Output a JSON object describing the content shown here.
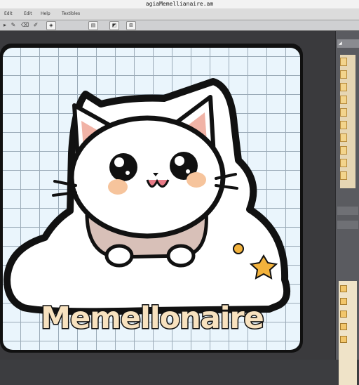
{
  "window": {
    "title": "agiaMemellianaire.am"
  },
  "menu": {
    "items": [
      "Edit",
      "Edit",
      "Help",
      "Textibles"
    ]
  },
  "toolbar": {
    "icons": [
      "select-icon",
      "pen-icon",
      "stamp-icon",
      "paint-icon",
      "fill-icon",
      "layer-icon",
      "grid-icon",
      "export-icon"
    ],
    "glyphs": [
      "▸",
      "✎",
      "⌫",
      "✐",
      "◈",
      "▤",
      "◩",
      "⊞"
    ]
  },
  "canvas": {
    "sticker_text": "Memellonaire",
    "colors": {
      "outline": "#111111",
      "fur": "#ffffff",
      "ear_inner": "#f1b3a6",
      "cheek": "#f6c49c",
      "text_fill": "#f8e2bf",
      "grid_bg": "#eaf5fc",
      "grid_line": "#9aaab7"
    }
  },
  "right_panel": {
    "header": "◢"
  }
}
